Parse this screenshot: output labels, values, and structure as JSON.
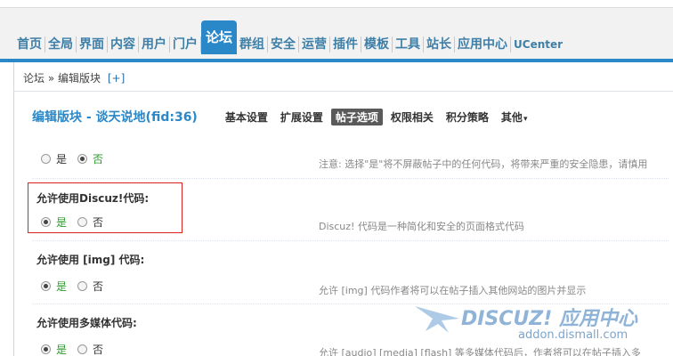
{
  "top_strip": [
    "",
    "",
    "",
    "",
    "",
    "",
    "",
    "",
    "",
    "",
    ""
  ],
  "nav": {
    "items": [
      {
        "label": "首页",
        "active": false
      },
      {
        "label": "全局",
        "active": false
      },
      {
        "label": "界面",
        "active": false
      },
      {
        "label": "内容",
        "active": false
      },
      {
        "label": "用户",
        "active": false
      },
      {
        "label": "门户",
        "active": false
      },
      {
        "label": "论坛",
        "active": true
      },
      {
        "label": "群组",
        "active": false
      },
      {
        "label": "安全",
        "active": false
      },
      {
        "label": "运营",
        "active": false
      },
      {
        "label": "插件",
        "active": false
      },
      {
        "label": "模板",
        "active": false
      },
      {
        "label": "工具",
        "active": false
      },
      {
        "label": "站长",
        "active": false
      },
      {
        "label": "应用中心",
        "active": false
      },
      {
        "label": "UCenter",
        "active": false
      }
    ]
  },
  "breadcrumb": {
    "root": "论坛",
    "sep": "»",
    "current": "编辑版块",
    "plus": "[+]"
  },
  "header": {
    "title": "编辑版块 - 谈天说地(fid:36)",
    "tabs": [
      "基本设置",
      "扩展设置",
      "帖子选项",
      "权限相关",
      "积分策略",
      "其他"
    ],
    "active_tab": "帖子选项",
    "more_caret": "▾"
  },
  "rows": [
    {
      "title": "",
      "yes": "是",
      "no": "否",
      "selected": "no",
      "hint": "注意: 选择\"是\"将不屏蔽帖子中的任何代码，将带来严重的安全隐患，请慎用"
    },
    {
      "title": "允许使用Discuz!代码:",
      "yes": "是",
      "no": "否",
      "selected": "yes",
      "hint": "Discuz! 代码是一种简化和安全的页面格式代码"
    },
    {
      "title": "允许使用 [img] 代码:",
      "yes": "是",
      "no": "否",
      "selected": "yes",
      "hint": "允许 [img] 代码作者将可以在帖子插入其他网站的图片并显示"
    },
    {
      "title": "允许使用多媒体代码:",
      "yes": "是",
      "no": "否",
      "selected": "yes",
      "hint": "允许 [audio] [media] [flash] 等多媒体代码后，作者将可以在帖子插入多"
    }
  ],
  "watermark": {
    "brand": "DISCUZ! 应用中心",
    "url": "addon.dismall.com"
  },
  "colors": {
    "nav_active": "#2a87c8",
    "nav_text": "#3e7fa8",
    "title": "#2a87c8",
    "yes_green": "#2b9a2b",
    "highlight_red": "#dd2222"
  }
}
